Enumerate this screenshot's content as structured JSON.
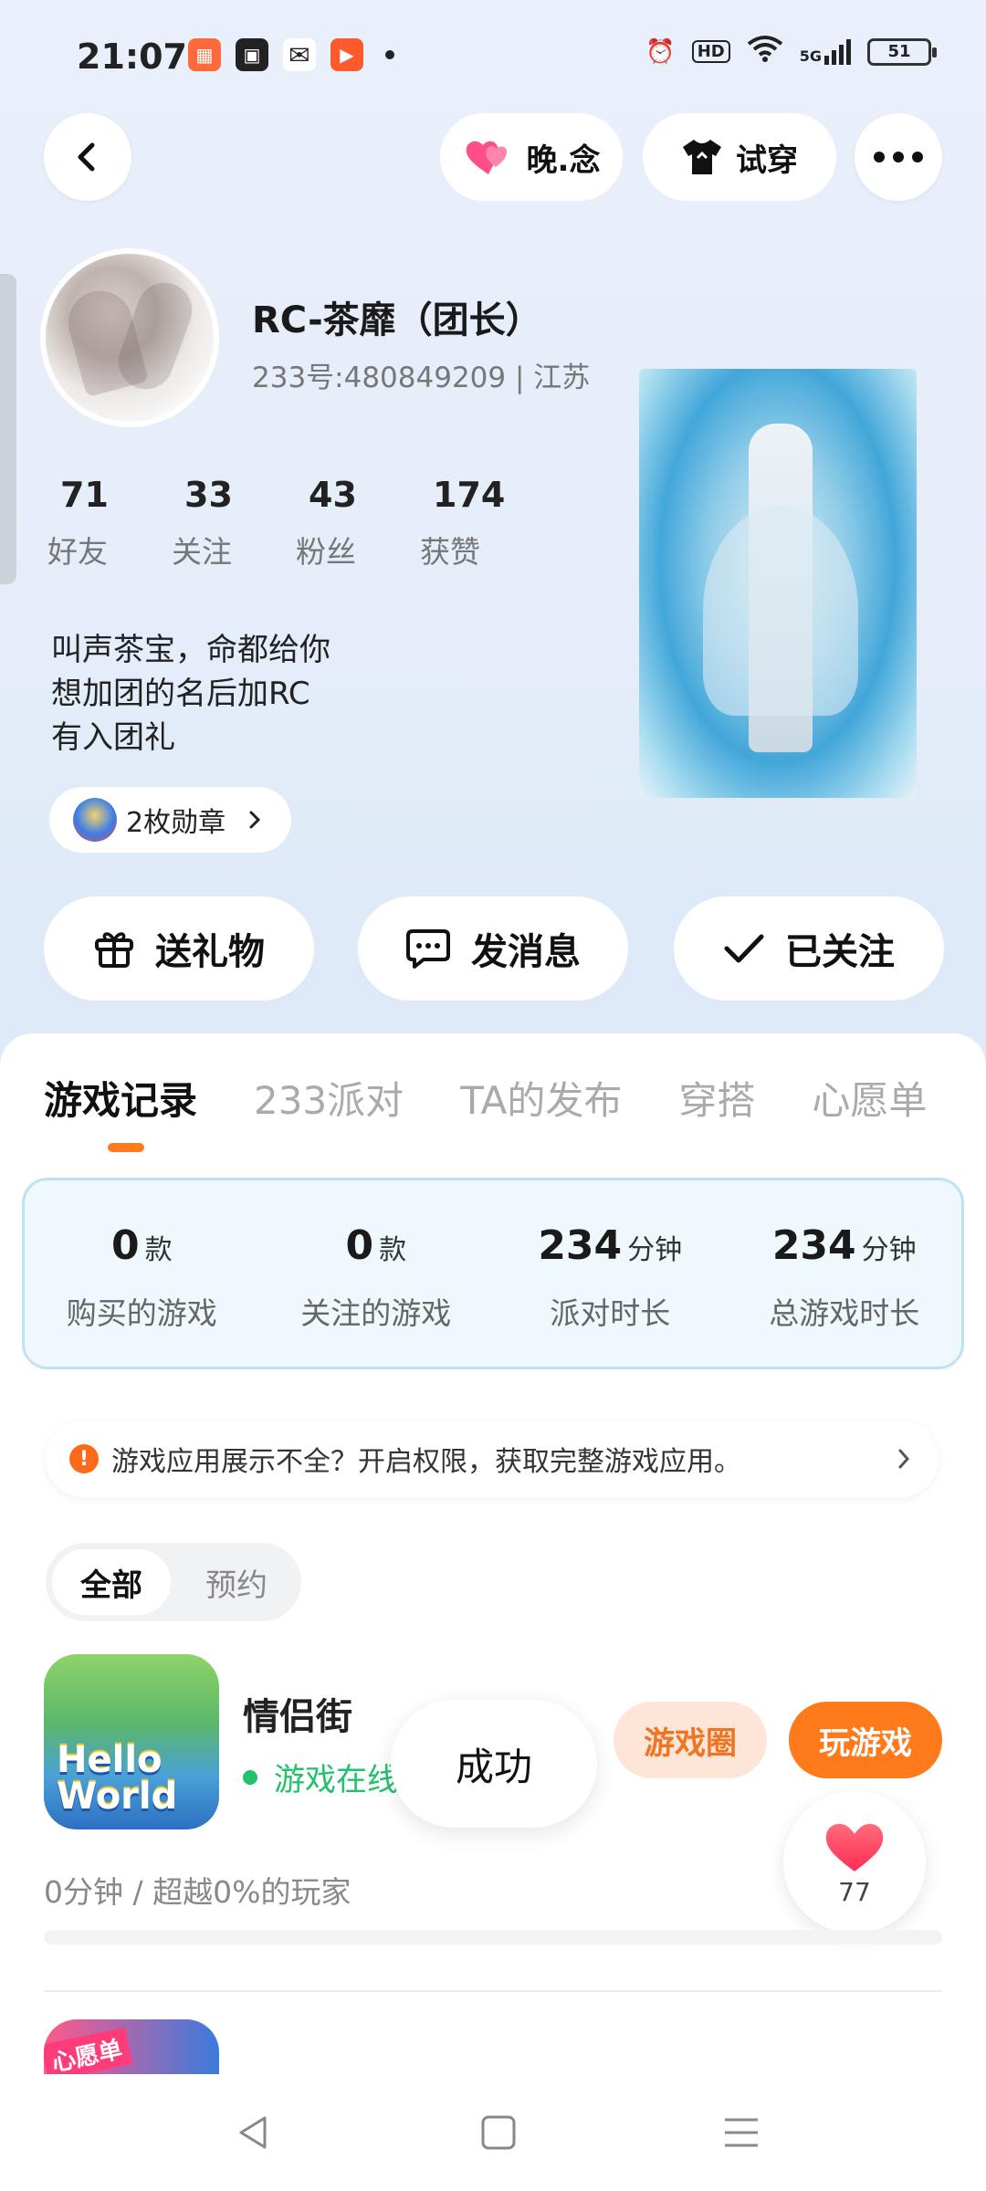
{
  "status_bar": {
    "time": "21:07",
    "battery": "51",
    "hd": "HD",
    "network": "5G"
  },
  "header": {
    "nickname_pill": "晚.念",
    "try_on": "试穿"
  },
  "profile": {
    "name": "RC-茶靡（团长）",
    "uid_line": "233号:480849209 | 江苏",
    "stats": [
      {
        "value": "71",
        "label": "好友"
      },
      {
        "value": "33",
        "label": "关注"
      },
      {
        "value": "43",
        "label": "粉丝"
      },
      {
        "value": "174",
        "label": "获赞"
      }
    ],
    "bio": [
      "叫声茶宝，命都给你",
      "想加团的名后加RC",
      "有入团礼"
    ],
    "medals": "2枚勋章"
  },
  "actions": {
    "gift": "送礼物",
    "message": "发消息",
    "followed": "已关注"
  },
  "tabs": [
    "游戏记录",
    "233派对",
    "TA的发布",
    "穿搭",
    "心愿单"
  ],
  "summary": [
    {
      "value": "0",
      "unit": "款",
      "label": "购买的游戏"
    },
    {
      "value": "0",
      "unit": "款",
      "label": "关注的游戏"
    },
    {
      "value": "234",
      "unit": "分钟",
      "label": "派对时长"
    },
    {
      "value": "234",
      "unit": "分钟",
      "label": "总游戏时长"
    }
  ],
  "notice": "游戏应用展示不全？开启权限，获取完整游戏应用。",
  "segment": {
    "all": "全部",
    "reserve": "预约"
  },
  "game": {
    "name": "情侣街",
    "status": "游戏在线",
    "icon_text": "Hello World",
    "circle_btn": "游戏圈",
    "play_btn": "玩游戏",
    "playtime": "0分钟 / 超越0%的玩家",
    "progress_percent": 0
  },
  "game2": {
    "tag": "心愿单"
  },
  "toast": "成功",
  "like": {
    "count": "77"
  },
  "colors": {
    "accent": "#ff7a1a",
    "online": "#23c16b"
  }
}
